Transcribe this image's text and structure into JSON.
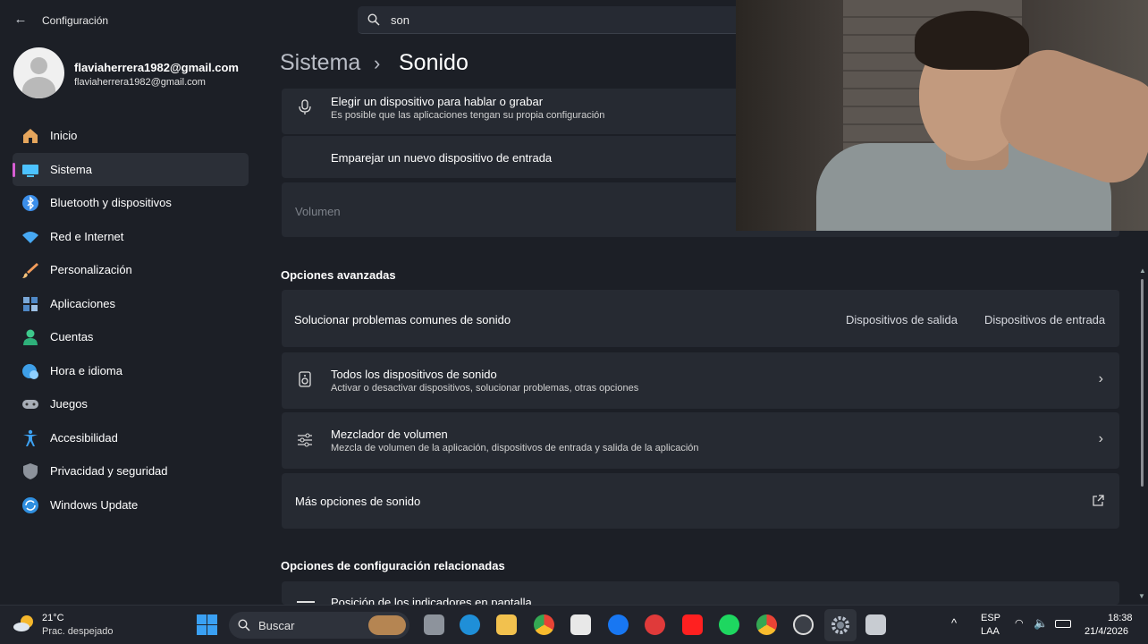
{
  "window": {
    "title": "Configuración",
    "back_icon": "back-arrow-icon"
  },
  "search": {
    "value": "son",
    "icon": "search-icon"
  },
  "profile": {
    "name": "flaviaherrera1982@gmail.com",
    "email": "flaviaherrera1982@gmail.com"
  },
  "nav": {
    "items": [
      {
        "label": "Inicio",
        "icon": "home-icon",
        "active": false
      },
      {
        "label": "Sistema",
        "icon": "monitor-icon",
        "active": true
      },
      {
        "label": "Bluetooth y dispositivos",
        "icon": "bluetooth-icon",
        "active": false
      },
      {
        "label": "Red e Internet",
        "icon": "wifi-icon",
        "active": false
      },
      {
        "label": "Personalización",
        "icon": "brush-icon",
        "active": false
      },
      {
        "label": "Aplicaciones",
        "icon": "apps-icon",
        "active": false
      },
      {
        "label": "Cuentas",
        "icon": "person-icon",
        "active": false
      },
      {
        "label": "Hora e idioma",
        "icon": "globe-clock-icon",
        "active": false
      },
      {
        "label": "Juegos",
        "icon": "gamepad-icon",
        "active": false
      },
      {
        "label": "Accesibilidad",
        "icon": "accessibility-icon",
        "active": false
      },
      {
        "label": "Privacidad y seguridad",
        "icon": "shield-icon",
        "active": false
      },
      {
        "label": "Windows Update",
        "icon": "update-icon",
        "active": false
      }
    ]
  },
  "header": {
    "parent": "Sistema",
    "separator": "›",
    "current": "Sonido"
  },
  "input_section": {
    "choose_device": {
      "title": "Elegir un dispositivo para hablar o grabar",
      "subtitle": "Es posible que las aplicaciones tengan su propia configuración"
    },
    "pair_device": {
      "title": "Emparejar un nuevo dispositivo de entrada"
    },
    "volume_label": "Volumen"
  },
  "advanced": {
    "heading": "Opciones avanzadas",
    "troubleshoot": {
      "title": "Solucionar problemas comunes de sonido",
      "link1": "Dispositivos de salida",
      "link2": "Dispositivos de entrada"
    },
    "all_devices": {
      "title": "Todos los dispositivos de sonido",
      "subtitle": "Activar o desactivar dispositivos, solucionar problemas, otras opciones"
    },
    "mixer": {
      "title": "Mezclador de volumen",
      "subtitle": "Mezcla de volumen de la aplicación, dispositivos de entrada y salida de la aplicación"
    },
    "more": {
      "title": "Más opciones de sonido"
    }
  },
  "related": {
    "heading": "Opciones de configuración relacionadas",
    "first_item": "Posición de los indicadores en pantalla"
  },
  "taskbar": {
    "temp": "21°C",
    "weather": "Prac. despejado",
    "search_label": "Buscar",
    "lang_top": "ESP",
    "lang_bottom": "LAA",
    "time": "18:38",
    "date": "21/4/2026"
  },
  "colors": {
    "accent": "#d65ed3",
    "background": "#1c1f26",
    "card": "#262a32"
  }
}
